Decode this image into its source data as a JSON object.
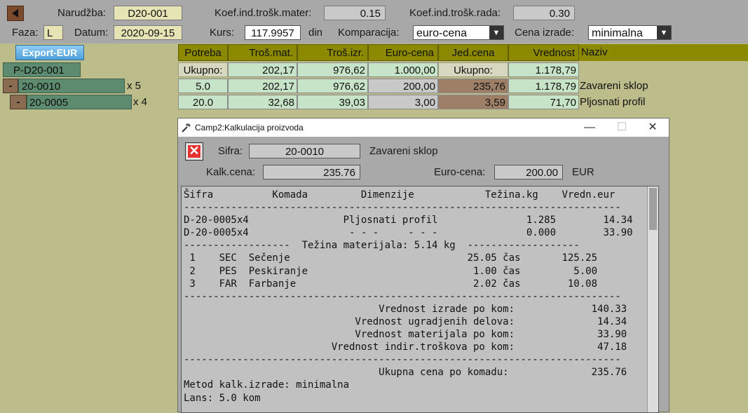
{
  "header": {
    "narudzba_label": "Narudžba:",
    "narudzba_value": "D20-001",
    "koef_mater_label": "Koef.ind.trošk.mater:",
    "koef_mater_value": "0.15",
    "koef_rada_label": "Koef.ind.trošk.rada:",
    "koef_rada_value": "0.30",
    "faza_label": "Faza:",
    "faza_value": "L",
    "datum_label": "Datum:",
    "datum_value": "2020-09-15",
    "kurs_label": "Kurs:",
    "kurs_value": "117.9957",
    "din_label": "din",
    "komparacija_label": "Komparacija:",
    "komparacija_value": "euro-cena",
    "cena_izrade_label": "Cena izrade:",
    "cena_izrade_value": "minimalna"
  },
  "export_button": "Export-EUR",
  "tree": {
    "root": "P-D20-001",
    "item1": "20-0010",
    "item1_mult": "x 5",
    "item2": "20-0005",
    "item2_mult": "x 4",
    "minus": "-"
  },
  "table": {
    "headers": [
      "Potreba",
      "Troš.mat.",
      "Troš.izr.",
      "Euro-cena",
      "Jed.cena",
      "Vrednost",
      "Naziv"
    ],
    "rows": [
      [
        "Ukupno:",
        "202,17",
        "976,62",
        "1.000,00",
        "Ukupno:",
        "1.178,79",
        ""
      ],
      [
        "5.0",
        "202,17",
        "976,62",
        "200,00",
        "235,76",
        "1.178,79",
        "Zavareni sklop"
      ],
      [
        "20.0",
        "32,68",
        "39,03",
        "3,00",
        "3,59",
        "71,70",
        "Pljosnati profil"
      ]
    ]
  },
  "dialog": {
    "title": "Camp2:Kalkulacija proizvoda",
    "minimize": "—",
    "maximize": "☐",
    "close": "✕",
    "sifra_label": "Sifra:",
    "sifra_value": "20-0010",
    "sifra_desc": "Zavareni sklop",
    "kalk_label": "Kalk.cena:",
    "kalk_value": "235.76",
    "euro_label": "Euro-cena:",
    "euro_value": "200.00",
    "eur_unit": "EUR",
    "report": "Šifra          Komada         Dimenzije            Težina.kg    Vredn.eur\n--------------------------------------------------------------------------\nD-20-0005x4                Pljosnati profil               1.285        14.34\nD-20-0005x4                 - - -     - - -               0.000        33.90\n------------------  Težina materijala: 5.14 kg  -------------------\n 1    SEC  Sečenje                              25.05 čas       125.25\n 2    PES  Peskiranje                            1.00 čas         5.00\n 3    FAR  Farbanje                              2.02 čas        10.08\n--------------------------------------------------------------------------\n                                 Vrednost izrade po kom:             140.33\n                             Vrednost ugradjenih delova:              14.34\n                             Vrednost materijala po kom:              33.90\n                         Vrednost indir.troškova po kom:              47.18\n--------------------------------------------------------------------------\n                                 Ukupna cena po komadu:              235.76\nMetod kalk.izrade: minimalna\nLans: 5.0 kom"
  },
  "colors": {
    "background": "#bcbd8b",
    "header_bar": "#a8a8a8",
    "table_header": "#8a8900",
    "mint": "#c8e4c8",
    "brown": "#9d7e66",
    "tree_green": "#5d8b6f"
  }
}
